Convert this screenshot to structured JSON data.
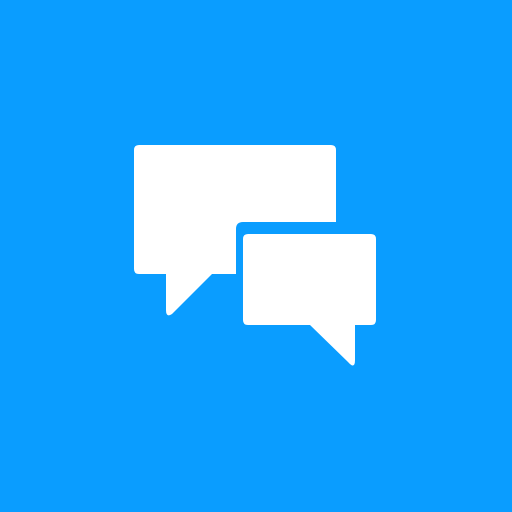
{
  "tile": {
    "background_color": "#0a9dff",
    "icon_color": "#ffffff"
  },
  "icon": {
    "name": "chat-bubbles-icon",
    "parts": [
      "speech-bubble-back-icon",
      "speech-bubble-front-icon"
    ]
  }
}
